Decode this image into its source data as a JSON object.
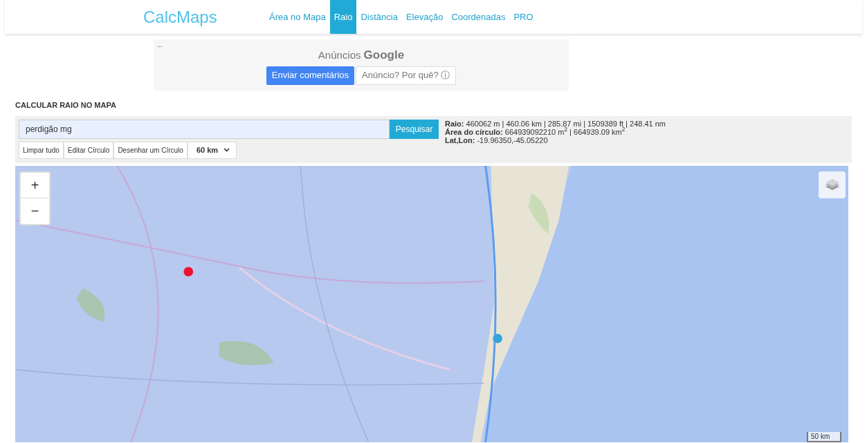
{
  "header": {
    "logo": "CalcMaps",
    "nav": [
      {
        "label": "Área no Mapa",
        "selected": false
      },
      {
        "label": "Raio",
        "selected": true
      },
      {
        "label": "Distância",
        "selected": false
      },
      {
        "label": "Elevação",
        "selected": false
      },
      {
        "label": "Coordenadas",
        "selected": false
      },
      {
        "label": "PRO",
        "selected": false
      }
    ]
  },
  "ad": {
    "back": "←",
    "title": "Anúncios",
    "brand": "Google",
    "buttons": [
      {
        "label": "Enviar comentários",
        "kind": "primary"
      },
      {
        "label": "Anúncio? Por quê? ⓘ",
        "kind": "secondary"
      }
    ]
  },
  "section_title": "CALCULAR RAIO NO MAPA",
  "search": {
    "value": "perdigão mg",
    "button": "Pesquisar"
  },
  "tools": [
    "Limpar tudo",
    "Editar Círculo",
    "Desenhar um Círculo"
  ],
  "radius_select": {
    "value": "60 km"
  },
  "results": [
    {
      "label": "Raio:",
      "value": "460062 m | 460.06 km | 285.87 mi | 1509389 ft | 248.41 nm"
    },
    {
      "label": "Área do círculo:",
      "value": "664939092210 m$^{2}$ | 664939.09 km$^{2}$"
    },
    {
      "label": "Lat,Lon:",
      "value": "-19.96350,-45.05220"
    }
  ],
  "map": {
    "zoom_in": "+",
    "zoom_out": "−",
    "scale": "50 km"
  }
}
